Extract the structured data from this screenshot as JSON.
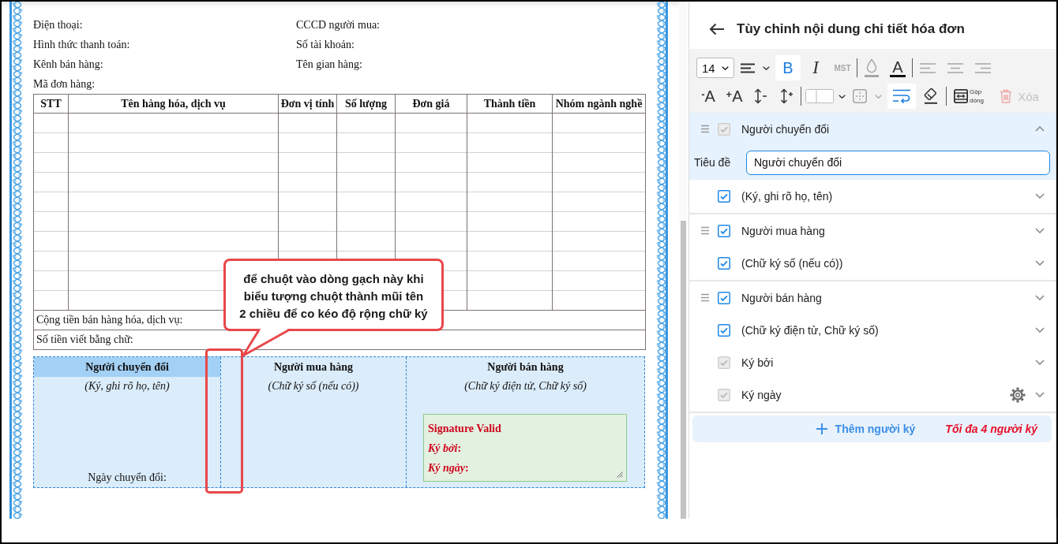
{
  "document": {
    "info_rows": [
      {
        "left": "Điện thoại:",
        "right": "CCCD người mua:"
      },
      {
        "left": "Hình thức thanh toán:",
        "right": "Số tài khoản:"
      },
      {
        "left": "Kênh bán hàng:",
        "right": "Tên gian hàng:"
      },
      {
        "left": "Mã đơn hàng:"
      }
    ],
    "table": {
      "columns": [
        "STT",
        "Tên hàng hóa, dịch vụ",
        "Đơn vị tính",
        "Số lượng",
        "Đơn giá",
        "Thành tiền",
        "Nhóm ngành nghề"
      ],
      "summary_rows": [
        "Cộng tiền bán hàng hóa, dịch vụ:",
        "Số tiền viết bằng chữ:"
      ]
    },
    "signatures": [
      {
        "title": "Người chuyển đổi",
        "note": "(Ký, ghi rõ họ, tên)",
        "selected": true,
        "footer": "Ngày chuyển đổi:"
      },
      {
        "title": "Người mua hàng",
        "note": "(Chữ ký số (nếu có))",
        "selected": false
      },
      {
        "title": "Người bán hàng",
        "note": "(Chữ ký điện tử, Chữ ký số)",
        "selected": false,
        "signature_box": {
          "status": "Signature Valid",
          "fields": [
            "*Ký bởi*:",
            "*Ký ngày*:"
          ]
        }
      }
    ],
    "callout": {
      "text": "để chuột vào dòng gạch này khi biểu tượng chuột thành mũi tên 2 chiều để co kéo độ rộng chữ ký"
    }
  },
  "panel": {
    "title": "Tùy chỉnh nội dung chi tiết hóa đơn",
    "toolbar": {
      "rows": [
        [
          [
            {
              "kind": "font-size",
              "value": "14",
              "selected": false,
              "disabled": false
            },
            {
              "kind": "line-style",
              "selected": false,
              "disabled": false
            },
            {
              "kind": "bold",
              "label": "B",
              "selected": true,
              "disabled": false
            },
            {
              "kind": "italic",
              "label": "I",
              "selected": false,
              "disabled": false
            },
            {
              "kind": "tax-code",
              "label": "MST",
              "selected": false,
              "disabled": true
            }
          ],
          [
            {
              "kind": "fill-color",
              "selected": false,
              "disabled": true
            },
            {
              "kind": "font-color",
              "label": "A",
              "selected": false,
              "disabled": false
            }
          ],
          [
            {
              "kind": "align-left",
              "selected": false,
              "disabled": true
            },
            {
              "kind": "align-center",
              "selected": false,
              "disabled": true
            },
            {
              "kind": "align-right",
              "selected": false,
              "disabled": true
            }
          ]
        ],
        [
          [
            {
              "kind": "font-smaller",
              "label": "$^{-}$A",
              "selected": false,
              "disabled": false
            },
            {
              "kind": "font-larger",
              "label": "$^{+}$A",
              "selected": false,
              "disabled": false
            },
            {
              "kind": "spacing-less",
              "selected": false,
              "disabled": false
            },
            {
              "kind": "spacing-more",
              "selected": false,
              "disabled": false
            }
          ],
          [
            {
              "kind": "border-style",
              "selected": false,
              "disabled": false
            },
            {
              "kind": "cell-padding",
              "selected": false,
              "disabled": true
            },
            {
              "kind": "wrap-text",
              "selected": true,
              "disabled": false
            },
            {
              "kind": "clear-format",
              "selected": false,
              "disabled": false
            }
          ],
          [
            {
              "kind": "merge-rows",
              "label": "Gộp dòng",
              "selected": false,
              "disabled": false
            },
            {
              "kind": "delete",
              "label": "Xóa",
              "selected": false,
              "disabled": true
            }
          ]
        ]
      ]
    },
    "signers": [
      {
        "title": "Người chuyển đổi",
        "checked": true,
        "disabled": true,
        "expanded": true,
        "title_field": {
          "label": "Tiêu đề",
          "value": "Người chuyển đổi"
        },
        "lines": [
          {
            "kind": "text",
            "text": "(Ký, ghi rõ họ, tên)",
            "checked": true,
            "disabled": false,
            "expanded": false
          }
        ]
      },
      {
        "title": "Người mua hàng",
        "checked": true,
        "disabled": false,
        "expanded": false,
        "lines": [
          {
            "kind": "text",
            "text": "(Chữ ký số (nếu có))",
            "checked": true,
            "disabled": false,
            "expanded": false
          }
        ]
      },
      {
        "title": "Người bán hàng",
        "checked": true,
        "disabled": false,
        "expanded": false,
        "lines": [
          {
            "kind": "text",
            "text": "(Chữ ký điện tử, Chữ ký số)",
            "checked": true,
            "disabled": false,
            "expanded": false
          },
          {
            "kind": "text",
            "text": "Ký bởi",
            "checked": true,
            "disabled": true,
            "expanded": false
          },
          {
            "kind": "date",
            "text": "Ký ngày",
            "checked": true,
            "disabled": true,
            "expanded": false
          }
        ]
      }
    ],
    "add_label": "Thêm người ký",
    "limit_note": "Tối đa 4 người ký"
  }
}
